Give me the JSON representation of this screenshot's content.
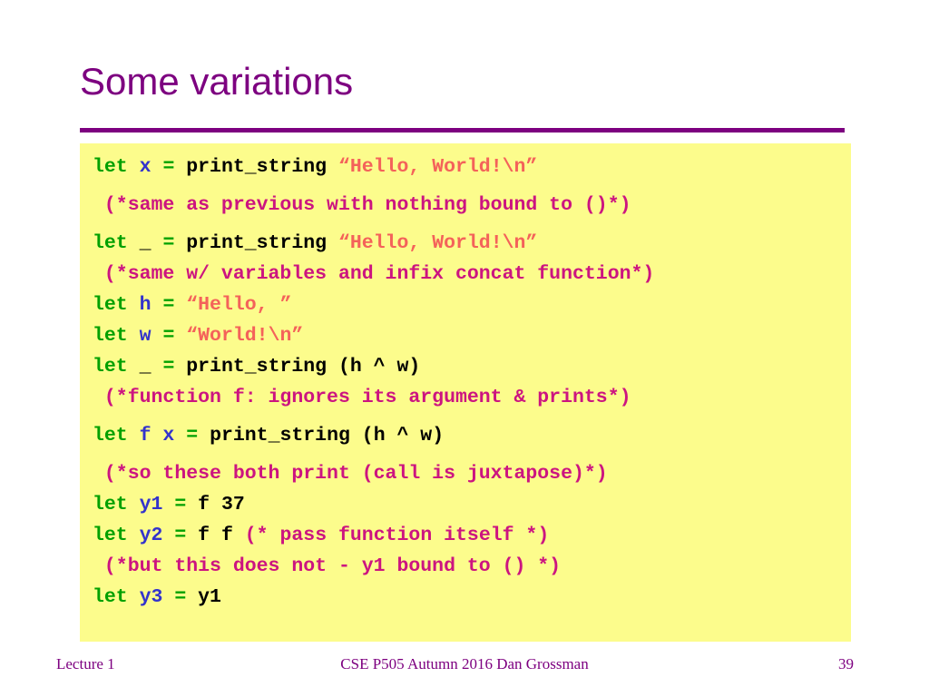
{
  "slide": {
    "title": "Some variations",
    "accent_color": "#7D0080",
    "code_panel_bg": "#FCFC8C",
    "syntax_colors": {
      "keyword": "#00A000",
      "variable": "#3333CC",
      "expression": "#000000",
      "string": "#F4625A",
      "comment": "#CC1480"
    }
  },
  "code": {
    "line1": {
      "kw_let": "let",
      "var": "x",
      "kw_eq": "=",
      "fn": "print_string",
      "str": "“Hello, World!\\n”"
    },
    "line2": {
      "comment": " (*same as previous with nothing bound to ()*)"
    },
    "line3": {
      "kw_let": "let",
      "var": "_",
      "kw_eq": "=",
      "fn": "print_string",
      "str": "“Hello, World!\\n”"
    },
    "line4": {
      "comment": " (*same w/ variables and infix concat function*)"
    },
    "line5": {
      "kw_let": "let",
      "var": "h",
      "kw_eq": "=",
      "str": "“Hello, ”"
    },
    "line6": {
      "kw_let": "let",
      "var": "w",
      "kw_eq": "=",
      "str": "“World!\\n”"
    },
    "line7": {
      "kw_let": "let",
      "var": "_",
      "kw_eq": "=",
      "fn": "print_string (h ^ w)"
    },
    "line8": {
      "comment": " (*function f: ignores its argument & prints*)"
    },
    "line9": {
      "kw_let": "let",
      "var": "f x",
      "kw_eq": "=",
      "fn": "print_string (h ^ w)"
    },
    "line10": {
      "comment": " (*so these both print (call is juxtapose)*)"
    },
    "line11": {
      "kw_let": "let",
      "var": "y1",
      "kw_eq": "=",
      "fn": "f 37"
    },
    "line12": {
      "kw_let": "let",
      "var": "y2",
      "kw_eq": "=",
      "fn": "f f",
      "comment": "(* pass function itself *)"
    },
    "line13": {
      "comment": " (*but this does not - y1 bound to () *)"
    },
    "line14": {
      "kw_let": "let",
      "var": "y3",
      "kw_eq": "=",
      "fn": "y1"
    }
  },
  "footer": {
    "left": "Lecture 1",
    "center": "CSE P505 Autumn 2016  Dan Grossman",
    "right": "39"
  }
}
